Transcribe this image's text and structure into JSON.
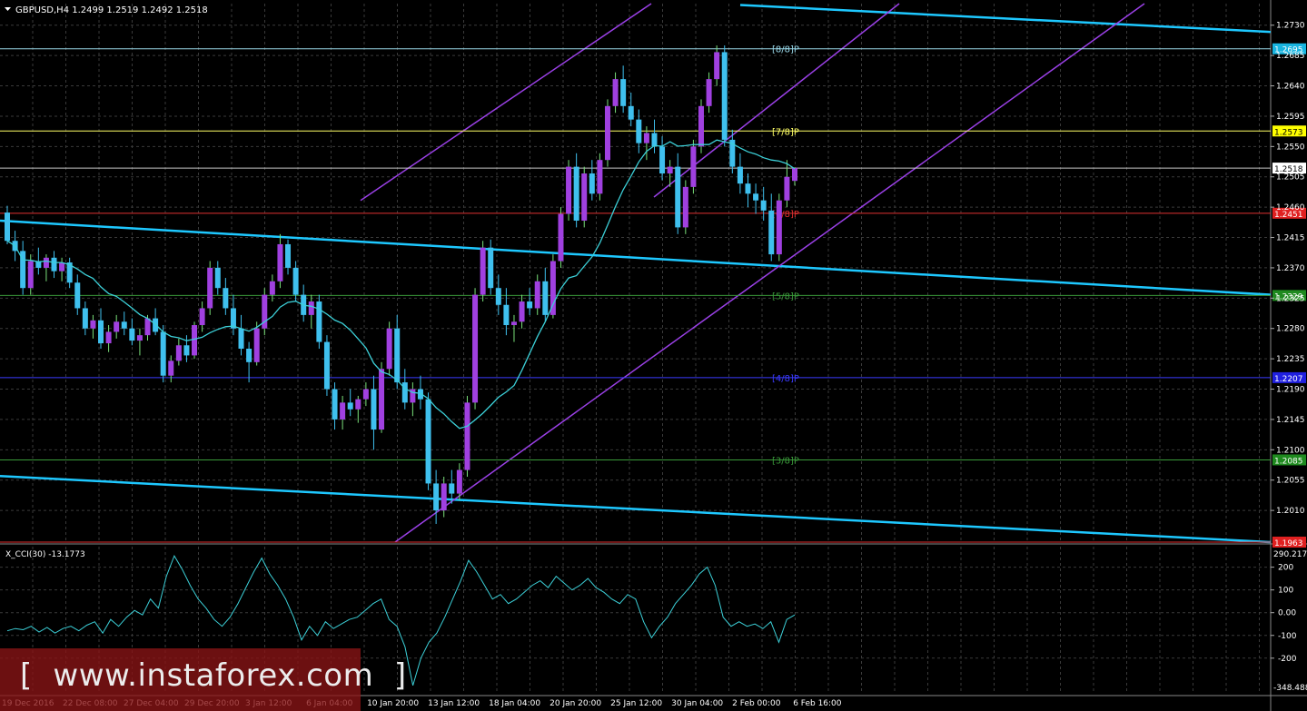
{
  "chart_data": {
    "type": "candlestick",
    "symbol_header": {
      "symbol": "GBPUSD,H4",
      "open": "1.2499",
      "high": "1.2519",
      "low": "1.2492",
      "close": "1.2518"
    },
    "y_axis": {
      "ylim": [
        1.1963,
        1.2762
      ],
      "ticks": [
        "1.2730",
        "1.2685",
        "1.2640",
        "1.2595",
        "1.2550",
        "1.2505",
        "1.2460",
        "1.2415",
        "1.2370",
        "1.2325",
        "1.2280",
        "1.2235",
        "1.2190",
        "1.2145",
        "1.2100",
        "1.2055",
        "1.2010"
      ]
    },
    "x_axis_labels": [
      "19 Dec 2016",
      "22 Dec 08:00",
      "27 Dec 04:00",
      "29 Dec 20:00",
      "3 Jan 12:00",
      "6 Jan 04:00",
      "10 Jan 20:00",
      "13 Jan 12:00",
      "18 Jan 04:00",
      "20 Jan 20:00",
      "25 Jan 12:00",
      "30 Jan 04:00",
      "2 Feb 00:00",
      "6 Feb 16:00"
    ],
    "price_levels": [
      {
        "label": "[8/8]P",
        "value": 1.2695,
        "tag": "1.2695",
        "color": "#9ad9ea",
        "tag_bg": "#18b4e0",
        "tag_color": "#ffffff"
      },
      {
        "label": "[7/8]P",
        "value": 1.2573,
        "tag": "1.2573",
        "color": "#ffff66",
        "tag_bg": "#ffff00",
        "tag_color": "#000000"
      },
      {
        "label": "",
        "value": 1.2518,
        "tag": "1.2518",
        "color": "#c8c8c8",
        "tag_bg": "#ffffff",
        "tag_color": "#000000"
      },
      {
        "label": "[6/8]P",
        "value": 1.2451,
        "tag": "1.2451",
        "color": "#e03030",
        "tag_bg": "#e02020",
        "tag_color": "#ffffff"
      },
      {
        "label": "[5/8]P",
        "value": 1.2329,
        "tag": "1.2329",
        "color": "#3a9a3a",
        "tag_bg": "#1f8a1f",
        "tag_color": "#ffffff"
      },
      {
        "label": "[4/8]P",
        "value": 1.2207,
        "tag": "1.2207",
        "color": "#3a3aff",
        "tag_bg": "#2020e0",
        "tag_color": "#ffffff"
      },
      {
        "label": "[3/8]P",
        "value": 1.2085,
        "tag": "1.2085",
        "color": "#3a9a3a",
        "tag_bg": "#1f8a1f",
        "tag_color": "#ffffff"
      },
      {
        "label": "",
        "value": 1.1963,
        "tag": "1.1963",
        "color": "#e03030",
        "tag_bg": "#e02020",
        "tag_color": "#ffffff"
      }
    ],
    "sma_series_name": "",
    "candles_ohlc": [
      [
        1.2452,
        1.2462,
        1.2405,
        1.241
      ],
      [
        1.241,
        1.2425,
        1.238,
        1.2395
      ],
      [
        1.2395,
        1.241,
        1.233,
        1.234
      ],
      [
        1.234,
        1.239,
        1.233,
        1.238
      ],
      [
        1.238,
        1.24,
        1.236,
        1.237
      ],
      [
        1.237,
        1.239,
        1.235,
        1.2385
      ],
      [
        1.2385,
        1.2395,
        1.2355,
        1.2365
      ],
      [
        1.2365,
        1.2385,
        1.235,
        1.2378
      ],
      [
        1.2378,
        1.2385,
        1.234,
        1.2348
      ],
      [
        1.2348,
        1.236,
        1.23,
        1.231
      ],
      [
        1.231,
        1.232,
        1.227,
        1.228
      ],
      [
        1.228,
        1.23,
        1.2265,
        1.2292
      ],
      [
        1.2292,
        1.231,
        1.225,
        1.2258
      ],
      [
        1.2258,
        1.2285,
        1.2245,
        1.2275
      ],
      [
        1.2275,
        1.23,
        1.2265,
        1.229
      ],
      [
        1.229,
        1.2305,
        1.227,
        1.228
      ],
      [
        1.228,
        1.2295,
        1.2255,
        1.2262
      ],
      [
        1.2262,
        1.228,
        1.224,
        1.227
      ],
      [
        1.227,
        1.23,
        1.2262,
        1.2295
      ],
      [
        1.2295,
        1.231,
        1.227,
        1.2275
      ],
      [
        1.2275,
        1.2285,
        1.22,
        1.221
      ],
      [
        1.221,
        1.224,
        1.22,
        1.2232
      ],
      [
        1.2232,
        1.2265,
        1.2225,
        1.2255
      ],
      [
        1.2255,
        1.227,
        1.223,
        1.224
      ],
      [
        1.224,
        1.229,
        1.2235,
        1.2285
      ],
      [
        1.2285,
        1.232,
        1.2275,
        1.231
      ],
      [
        1.231,
        1.238,
        1.23,
        1.237
      ],
      [
        1.237,
        1.238,
        1.233,
        1.234
      ],
      [
        1.234,
        1.2355,
        1.23,
        1.231
      ],
      [
        1.231,
        1.233,
        1.227,
        1.228
      ],
      [
        1.228,
        1.23,
        1.224,
        1.225
      ],
      [
        1.225,
        1.226,
        1.22,
        1.223
      ],
      [
        1.223,
        1.229,
        1.2225,
        1.228
      ],
      [
        1.228,
        1.234,
        1.227,
        1.233
      ],
      [
        1.233,
        1.236,
        1.232,
        1.235
      ],
      [
        1.235,
        1.242,
        1.234,
        1.2405
      ],
      [
        1.2405,
        1.2412,
        1.236,
        1.237
      ],
      [
        1.237,
        1.238,
        1.232,
        1.233
      ],
      [
        1.233,
        1.2345,
        1.229,
        1.23
      ],
      [
        1.23,
        1.233,
        1.228,
        1.232
      ],
      [
        1.232,
        1.233,
        1.225,
        1.226
      ],
      [
        1.226,
        1.227,
        1.218,
        1.219
      ],
      [
        1.219,
        1.22,
        1.213,
        1.2145
      ],
      [
        1.2145,
        1.218,
        1.213,
        1.217
      ],
      [
        1.217,
        1.219,
        1.215,
        1.216
      ],
      [
        1.216,
        1.218,
        1.214,
        1.2175
      ],
      [
        1.2175,
        1.22,
        1.2165,
        1.219
      ],
      [
        1.219,
        1.221,
        1.21,
        1.213
      ],
      [
        1.213,
        1.223,
        1.2125,
        1.222
      ],
      [
        1.222,
        1.229,
        1.221,
        1.228
      ],
      [
        1.228,
        1.23,
        1.219,
        1.22
      ],
      [
        1.22,
        1.222,
        1.216,
        1.217
      ],
      [
        1.217,
        1.22,
        1.215,
        1.219
      ],
      [
        1.219,
        1.221,
        1.216,
        1.2175
      ],
      [
        1.2175,
        1.2185,
        1.204,
        1.205
      ],
      [
        1.205,
        1.207,
        1.199,
        1.201
      ],
      [
        1.201,
        1.206,
        1.2,
        1.205
      ],
      [
        1.205,
        1.207,
        1.202,
        1.2035
      ],
      [
        1.2035,
        1.208,
        1.2025,
        1.207
      ],
      [
        1.207,
        1.218,
        1.206,
        1.217
      ],
      [
        1.217,
        1.234,
        1.216,
        1.233
      ],
      [
        1.233,
        1.241,
        1.232,
        1.24
      ],
      [
        1.24,
        1.2412,
        1.233,
        1.234
      ],
      [
        1.234,
        1.236,
        1.23,
        1.2315
      ],
      [
        1.2315,
        1.234,
        1.227,
        1.2285
      ],
      [
        1.2285,
        1.23,
        1.226,
        1.229
      ],
      [
        1.229,
        1.233,
        1.228,
        1.232
      ],
      [
        1.232,
        1.234,
        1.23,
        1.231
      ],
      [
        1.231,
        1.236,
        1.23,
        1.235
      ],
      [
        1.235,
        1.237,
        1.229,
        1.23
      ],
      [
        1.23,
        1.239,
        1.2295,
        1.238
      ],
      [
        1.238,
        1.246,
        1.237,
        1.245
      ],
      [
        1.245,
        1.253,
        1.244,
        1.252
      ],
      [
        1.252,
        1.254,
        1.243,
        1.244
      ],
      [
        1.244,
        1.252,
        1.243,
        1.251
      ],
      [
        1.251,
        1.253,
        1.247,
        1.248
      ],
      [
        1.248,
        1.254,
        1.247,
        1.253
      ],
      [
        1.253,
        1.262,
        1.252,
        1.261
      ],
      [
        1.261,
        1.266,
        1.26,
        1.265
      ],
      [
        1.265,
        1.267,
        1.26,
        1.261
      ],
      [
        1.261,
        1.263,
        1.258,
        1.259
      ],
      [
        1.259,
        1.2605,
        1.254,
        1.2555
      ],
      [
        1.2555,
        1.258,
        1.253,
        1.257
      ],
      [
        1.257,
        1.259,
        1.254,
        1.255
      ],
      [
        1.255,
        1.2565,
        1.25,
        1.251
      ],
      [
        1.251,
        1.253,
        1.249,
        1.252
      ],
      [
        1.252,
        1.254,
        1.242,
        1.243
      ],
      [
        1.243,
        1.25,
        1.242,
        1.249
      ],
      [
        1.249,
        1.256,
        1.248,
        1.255
      ],
      [
        1.255,
        1.262,
        1.254,
        1.261
      ],
      [
        1.261,
        1.266,
        1.26,
        1.265
      ],
      [
        1.265,
        1.27,
        1.264,
        1.269
      ],
      [
        1.269,
        1.27,
        1.255,
        1.256
      ],
      [
        1.256,
        1.2575,
        1.251,
        1.252
      ],
      [
        1.252,
        1.254,
        1.248,
        1.2495
      ],
      [
        1.2495,
        1.251,
        1.246,
        1.248
      ],
      [
        1.248,
        1.2495,
        1.245,
        1.247
      ],
      [
        1.247,
        1.249,
        1.244,
        1.2455
      ],
      [
        1.2455,
        1.248,
        1.238,
        1.239
      ],
      [
        1.239,
        1.248,
        1.238,
        1.247
      ],
      [
        1.247,
        1.253,
        1.246,
        1.2505
      ],
      [
        1.2499,
        1.2519,
        1.2492,
        1.2518
      ]
    ],
    "cci": {
      "header": "X_CCI(30) -13.1773",
      "max_label": "290.2178",
      "min_label": "-348.4880",
      "ylim": [
        -348.488,
        290.2178
      ],
      "ticks": [
        "200",
        "100",
        "0.00",
        "-100",
        "-200"
      ],
      "values": [
        -80,
        -70,
        -75,
        -60,
        -85,
        -65,
        -90,
        -70,
        -60,
        -80,
        -55,
        -40,
        -90,
        -30,
        -60,
        -20,
        10,
        -10,
        60,
        20,
        160,
        250,
        190,
        120,
        60,
        20,
        -30,
        -60,
        -20,
        40,
        110,
        180,
        240,
        170,
        120,
        60,
        -20,
        -120,
        -60,
        -100,
        -40,
        -70,
        -50,
        -30,
        -20,
        10,
        40,
        60,
        -30,
        -60,
        -150,
        -320,
        -200,
        -130,
        -90,
        -20,
        60,
        140,
        230,
        180,
        120,
        60,
        80,
        40,
        60,
        90,
        120,
        140,
        110,
        160,
        130,
        100,
        120,
        150,
        110,
        90,
        60,
        40,
        80,
        60,
        -40,
        -110,
        -60,
        -20,
        40,
        80,
        120,
        170,
        200,
        120,
        -20,
        -60,
        -40,
        -60,
        -50,
        -70,
        -40,
        -130,
        -30,
        -10
      ]
    },
    "watermark": "[  www.instaforex.com  ]"
  }
}
